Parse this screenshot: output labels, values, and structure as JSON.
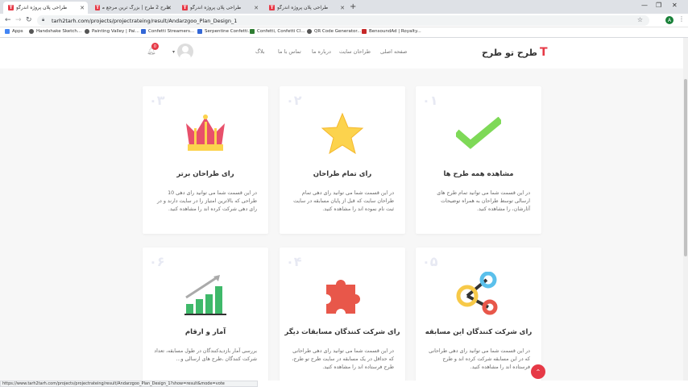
{
  "browser": {
    "tabs": [
      {
        "label": "طراحی پلان پروژه اندرگو",
        "icon_color": "#e63946",
        "active": true
      },
      {
        "label": "طرح 2 طرح | بزرگ ترین مرجع مسا",
        "icon_color": "#e63946",
        "active": false
      },
      {
        "label": "طراحی پلان پروژه اندرگو",
        "icon_color": "#e63946",
        "active": false
      },
      {
        "label": "طراحی پلان پروژه اندرگو",
        "icon_color": "#e63946",
        "active": false
      }
    ],
    "new_tab": "+",
    "url": "tarh2tarh.com/projects/projectrateing/result/Andarzgoo_Plan_Design_1",
    "bookmarks": [
      "Apps",
      "Handshake Sketch...",
      "Painting Valley | Pai...",
      "Confetti Streamers...",
      "Serpentine Confetti...",
      "Confetti, Confetti Cl...",
      "QR Code Generator...",
      "BensoundAd | Royalty..."
    ],
    "profile_initial": "A"
  },
  "header": {
    "logo_text": "طرح تو طرح",
    "logo_letter": "T",
    "nav": [
      "صفحه اصلی",
      "طراحان سایت",
      "درباره ما",
      "تماس با ما",
      "بلاگ"
    ],
    "notification_count": "0"
  },
  "cards": [
    {
      "num": "۰۱",
      "title": "مشاهده همه طرح ها",
      "desc": "در این قسمت شما می توانید تمام طرح های ارسالی توسط طراحان به همراه توضیحات آثارشان، را مشاهده کنید.",
      "icon": "check-icon"
    },
    {
      "num": "۰۲",
      "title": "رای تمام طراحان",
      "desc": "در این قسمت شما می توانید رای دهی تمام طراحان سایت که قبل از پایان مسابقه در سایت ثبت نام نموده اند را مشاهده کنید.",
      "icon": "star-icon"
    },
    {
      "num": "۰۳",
      "title": "رای طراحان برتر",
      "desc": "در این قسمت شما می توانید رای دهی 10 طراحی که بالاترین امتیاز را در سایت دارند و در رای دهی شرکت کرده اند را مشاهده کنید.",
      "icon": "crown-icon"
    },
    {
      "num": "۰۵",
      "title": "رای شرکت کنندگان این مسابقه",
      "desc": "در این قسمت شما می توانید رای دهی طراحانی که در این مسابقه شرکت کرده اند و طرح فرستاده اند را مشاهده کنید.",
      "icon": "molecule-icon"
    },
    {
      "num": "۰۴",
      "title": "رای شرکت کنندگان مسابقات دیگر",
      "desc": "در این قسمت شما می توانید رای دهی طراحانی که حداقل در یک مسابقه در سایت طرح تو طرح، طرح فرستاده اند را مشاهده کنید.",
      "icon": "puzzle-icon"
    },
    {
      "num": "۰۶",
      "title": "آمار و ارقام",
      "desc": "بررسی آمار بازدیدکنندگان در طول مسابقه، تعداد شرکت کنندگان ،طرح های ارسالی و...",
      "icon": "chart-growth-icon"
    }
  ],
  "status_url": "https://www.tarh2tarh.com/projects/projectrateing/result/Andarzgoo_Plan_Design_1?show=result&mode=vote",
  "to_top": "⌃",
  "colors": {
    "brand_red": "#e63946",
    "check_green": "#7ed957",
    "star_yellow": "#fcd34d",
    "crown_red": "#e8506b",
    "puzzle_red": "#e8574a",
    "chart_green": "#3fb96a"
  }
}
